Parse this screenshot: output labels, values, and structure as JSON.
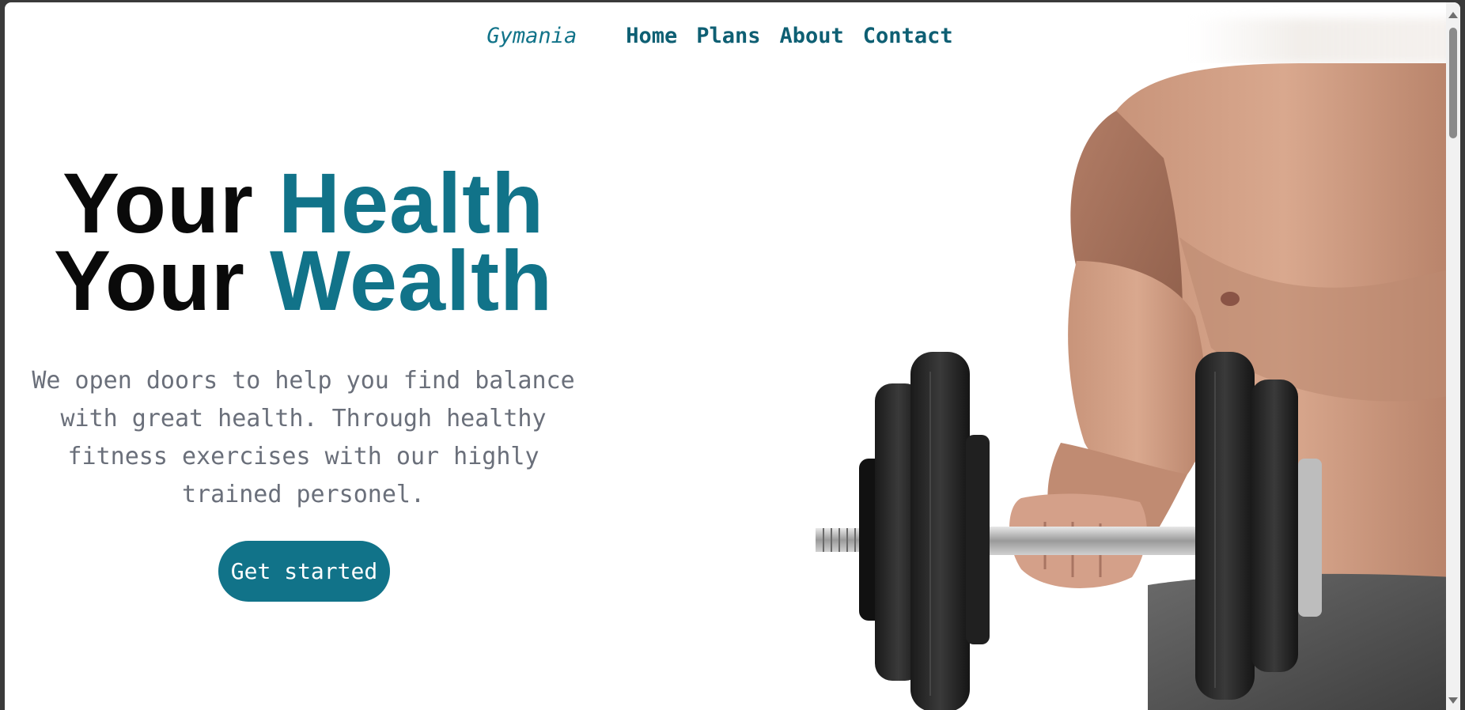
{
  "nav": {
    "brand": "Gymania",
    "links": [
      "Home",
      "Plans",
      "About",
      "Contact"
    ]
  },
  "hero": {
    "line1_plain": "Your",
    "line1_accent": "Health",
    "line2_plain": "Your",
    "line2_accent": "Wealth",
    "description": "We open doors to help you find balance with great health. Through healthy fitness exercises with our highly trained personel.",
    "cta_label": "Get started"
  },
  "colors": {
    "accent": "#117389",
    "nav_text": "#0e5f73",
    "body_text": "#6a6f7a",
    "button_bg": "#117389",
    "button_text": "#ffffff"
  },
  "images": {
    "hero_photo": "man-lifting-dumbbell-photo"
  }
}
